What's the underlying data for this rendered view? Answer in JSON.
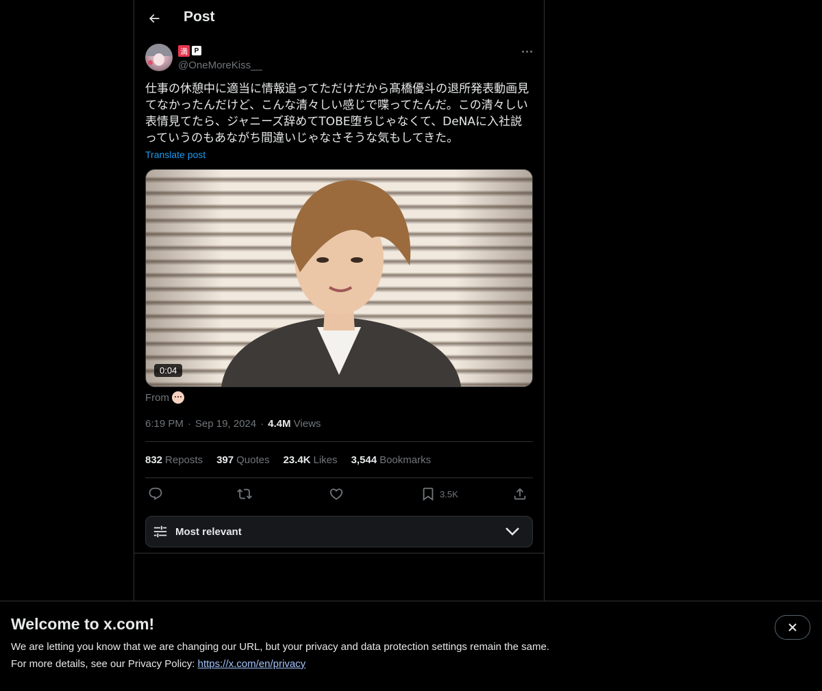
{
  "header": {
    "title": "Post"
  },
  "author": {
    "badge_main": "満",
    "badge_small": "P",
    "handle": "@OneMoreKiss__"
  },
  "post": {
    "text": "仕事の休憩中に適当に情報追ってただけだから髙橋優斗の退所発表動画見てなかったんだけど、こんな清々しい感じで喋ってたんだ。この清々しい表情見てたら、ジャニーズ辞めてTOBE堕ちじゃなくて、DeNAに入社説っていうのもあながち間違いじゃなさそうな気もしてきた。",
    "translate_label": "Translate post",
    "video_duration": "0:04",
    "from_label": "From"
  },
  "meta": {
    "time": "6:19 PM",
    "date": "Sep 19, 2024",
    "views_count": "4.4M",
    "views_label": "Views",
    "sep": "·"
  },
  "stats": [
    {
      "count": "832",
      "label": "Reposts"
    },
    {
      "count": "397",
      "label": "Quotes"
    },
    {
      "count": "23.4K",
      "label": "Likes"
    },
    {
      "count": "3,544",
      "label": "Bookmarks"
    }
  ],
  "actions": {
    "bookmark_count": "3.5K"
  },
  "sort": {
    "label": "Most relevant"
  },
  "banner": {
    "title": "Welcome to x.com!",
    "line1": "We are letting you know that we are changing our URL, but your privacy and data protection settings remain the same.",
    "line2_prefix": "For more details, see our Privacy Policy:",
    "link": "https://x.com/en/privacy"
  }
}
